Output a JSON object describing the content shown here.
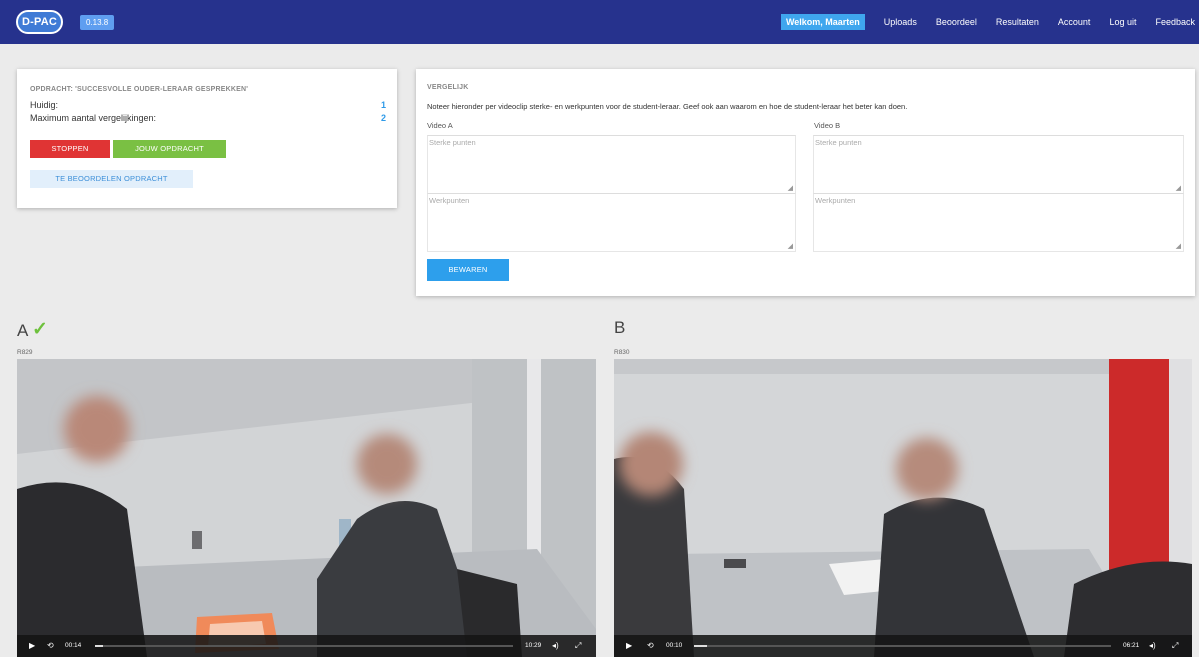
{
  "app": {
    "logo_text": "D-PAC",
    "version": "0.13.8"
  },
  "nav": {
    "welcome": "Welkom, Maarten",
    "items": [
      "Uploads",
      "Beoordeel",
      "Resultaten",
      "Account",
      "Log uit",
      "Feedback"
    ]
  },
  "assignment": {
    "title": "OPDRACHT: 'SUCCESVOLLE OUDER-LERAAR GESPREKKEN'",
    "current_label": "Huidig:",
    "current_value": "1",
    "max_label": "Maximum aantal vergelijkingen:",
    "max_value": "2",
    "stop_button": "STOPPEN",
    "your_assignment_button": "JOUW OPDRACHT",
    "assess_button": "TE BEOORDELEN OPDRACHT"
  },
  "compare": {
    "title": "VERGELIJK",
    "instruction": "Noteer hieronder per videoclip sterke- en werkpunten voor de student-leraar. Geef ook aan waarom en hoe de student-leraar het beter kan doen.",
    "video_a_label": "Video A",
    "video_b_label": "Video B",
    "strengths_placeholder": "Sterke punten",
    "improvements_placeholder": "Werkpunten",
    "save_button": "BEWAREN"
  },
  "videos": {
    "a": {
      "letter": "A",
      "code": "R829",
      "current_time": "00:14",
      "duration": "10:29",
      "progress": 0.02
    },
    "b": {
      "letter": "B",
      "code": "R830",
      "current_time": "00:10",
      "duration": "06:21",
      "progress": 0.03
    }
  },
  "icons": {
    "check": "checkmark-icon",
    "play": "play-icon",
    "replay": "replay-icon",
    "volume": "volume-icon",
    "fullscreen": "fullscreen-icon"
  },
  "colors": {
    "navbar": "#26328d",
    "accent": "#2d9fec",
    "stop": "#e03434",
    "your_assignment": "#7ac043",
    "check": "#6ec13d"
  }
}
